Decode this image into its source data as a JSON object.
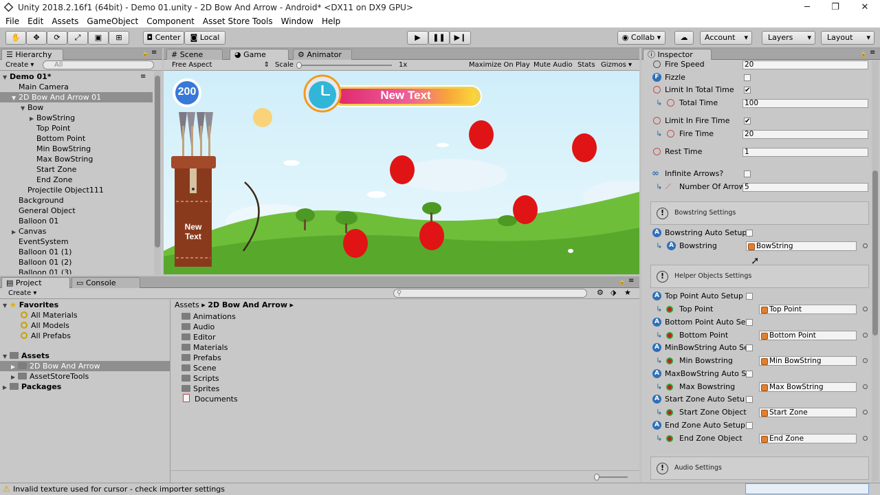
{
  "window": {
    "title": "Unity 2018.2.16f1 (64bit) - Demo 01.unity - 2D Bow And Arrow - Android* <DX11 on DX9 GPU>"
  },
  "menu": [
    "File",
    "Edit",
    "Assets",
    "GameObject",
    "Component",
    "Asset Store Tools",
    "Window",
    "Help"
  ],
  "toolbar": {
    "center": "Center",
    "local": "Local",
    "collab": "Collab",
    "account": "Account",
    "layers": "Layers",
    "layout": "Layout"
  },
  "hierarchy": {
    "tab": "Hierarchy",
    "create": "Create",
    "search_placeholder": "All",
    "rows": [
      {
        "label": "Demo 01*",
        "indent": 0,
        "arrow": "▼",
        "bold": true
      },
      {
        "label": "Main Camera",
        "indent": 1,
        "arrow": ""
      },
      {
        "label": "2D Bow And Arrow 01",
        "indent": 1,
        "arrow": "▼",
        "selected": true
      },
      {
        "label": "Bow",
        "indent": 2,
        "arrow": "▼"
      },
      {
        "label": "BowString",
        "indent": 3,
        "arrow": "▶"
      },
      {
        "label": "Top Point",
        "indent": 3,
        "arrow": ""
      },
      {
        "label": "Bottom Point",
        "indent": 3,
        "arrow": ""
      },
      {
        "label": "Min BowString",
        "indent": 3,
        "arrow": ""
      },
      {
        "label": "Max BowString",
        "indent": 3,
        "arrow": ""
      },
      {
        "label": "Start Zone",
        "indent": 3,
        "arrow": ""
      },
      {
        "label": "End Zone",
        "indent": 3,
        "arrow": ""
      },
      {
        "label": "Projectile Object111",
        "indent": 2,
        "arrow": ""
      },
      {
        "label": "Background",
        "indent": 1,
        "arrow": ""
      },
      {
        "label": "General Object",
        "indent": 1,
        "arrow": ""
      },
      {
        "label": "Balloon 01",
        "indent": 1,
        "arrow": ""
      },
      {
        "label": "Canvas",
        "indent": 1,
        "arrow": "▶"
      },
      {
        "label": "EventSystem",
        "indent": 1,
        "arrow": ""
      },
      {
        "label": "Balloon 01 (1)",
        "indent": 1,
        "arrow": ""
      },
      {
        "label": "Balloon 01 (2)",
        "indent": 1,
        "arrow": ""
      },
      {
        "label": "Balloon 01 (3)",
        "indent": 1,
        "arrow": ""
      }
    ]
  },
  "tabs": {
    "scene": "Scene",
    "game": "Game",
    "animator": "Animator"
  },
  "game": {
    "aspect": "Free Aspect",
    "scale_label": "Scale",
    "scale_value": "1x",
    "maximize": "Maximize On Play",
    "mute": "Mute Audio",
    "stats": "Stats",
    "gizmos": "Gizmos",
    "score": "200",
    "timer_text": "New Text",
    "quiver_text": "New\nText"
  },
  "project": {
    "tab": "Project",
    "console_tab": "Console",
    "create": "Create",
    "favorites": {
      "label": "Favorites",
      "items": [
        "All Materials",
        "All Models",
        "All Prefabs"
      ]
    },
    "assets_label": "Assets",
    "asset_items": [
      "2D Bow And Arrow",
      "AssetStoreTools"
    ],
    "packages_label": "Packages",
    "breadcrumb": [
      "Assets",
      "2D Bow And Arrow"
    ],
    "folders": [
      "Animations",
      "Audio",
      "Editor",
      "Materials",
      "Prefabs",
      "Scene",
      "Scripts",
      "Sprites",
      "Documents"
    ]
  },
  "inspector": {
    "tab": "Inspector",
    "fire_speed": {
      "label": "Fire Speed",
      "value": "20"
    },
    "fizzle": {
      "label": "Fizzle",
      "checked": false
    },
    "limit_total": {
      "label": "Limit In Total Time",
      "checked": true
    },
    "total_time": {
      "label": "Total Time",
      "value": "100"
    },
    "limit_fire": {
      "label": "Limit In Fire Time",
      "checked": true
    },
    "fire_time": {
      "label": "Fire Time",
      "value": "20"
    },
    "rest_time": {
      "label": "Rest Time",
      "value": "1"
    },
    "infinite": {
      "label": "Infinite Arrows?",
      "checked": false
    },
    "num_arrows": {
      "label": "Number Of Arrow",
      "value": "5"
    },
    "bowstring_section": "Bowstring Settings",
    "bowstring_auto": {
      "label": "Bowstring Auto Setup"
    },
    "bowstring": {
      "label": "Bowstring",
      "value": "BowString"
    },
    "helper_section": "Helper Objects Settings",
    "top_auto": {
      "label": "Top Point Auto Setup"
    },
    "top_point": {
      "label": "Top Point",
      "value": "Top Point"
    },
    "bottom_auto": {
      "label": "Bottom Point Auto Se"
    },
    "bottom_point": {
      "label": "Bottom Point",
      "value": "Bottom Point"
    },
    "min_auto": {
      "label": "MinBowString Auto Se"
    },
    "min_bowstring": {
      "label": "Min Bowstring",
      "value": "Min BowString"
    },
    "max_auto": {
      "label": "MaxBowString Auto S"
    },
    "max_bowstring": {
      "label": "Max Bowstring",
      "value": "Max BowString"
    },
    "start_auto": {
      "label": "Start Zone Auto Setu"
    },
    "start_zone": {
      "label": "Start Zone Object",
      "value": "Start Zone"
    },
    "end_auto": {
      "label": "End Zone Auto Setup"
    },
    "end_zone": {
      "label": "End Zone Object",
      "value": "End Zone"
    },
    "audio_section": "Audio Settings"
  },
  "status": {
    "message": "Invalid texture used for cursor - check importer settings"
  }
}
